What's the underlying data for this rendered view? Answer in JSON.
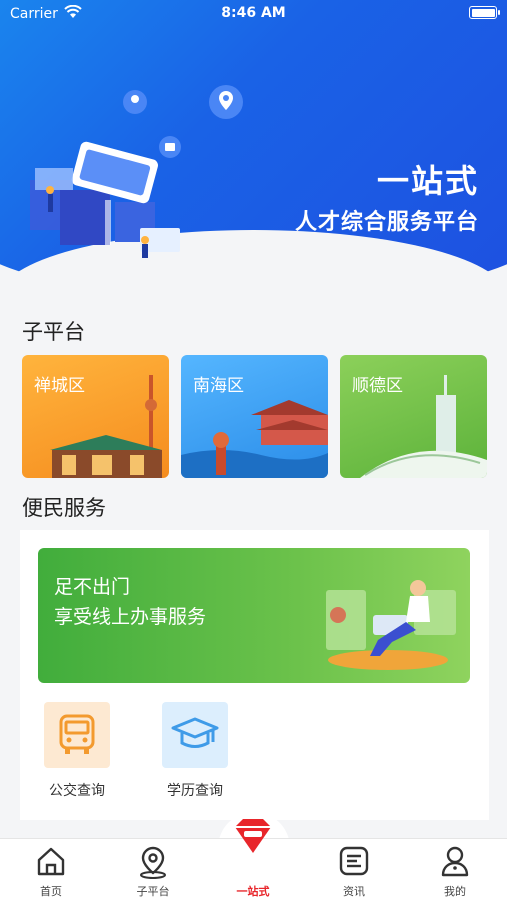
{
  "status_bar": {
    "carrier": "Carrier",
    "time": "8:46 AM"
  },
  "hero": {
    "title": "一站式",
    "subtitle": "人才综合服务平台"
  },
  "sub_platform": {
    "title": "子平台",
    "cards": [
      {
        "label": "禅城区"
      },
      {
        "label": "南海区"
      },
      {
        "label": "顺德区"
      }
    ]
  },
  "services": {
    "title": "便民服务",
    "banner": {
      "line1": "足不出门",
      "line2": "享受线上办事服务"
    },
    "items": [
      {
        "label": "公交查询",
        "icon": "bus-icon"
      },
      {
        "label": "学历查询",
        "icon": "graduation-cap-icon"
      }
    ]
  },
  "tabbar": {
    "tabs": [
      {
        "label": "首页",
        "icon": "home-icon"
      },
      {
        "label": "子平台",
        "icon": "location-pin-icon"
      },
      {
        "label": "一站式",
        "icon": "gem-icon",
        "active": true
      },
      {
        "label": "资讯",
        "icon": "news-icon"
      },
      {
        "label": "我的",
        "icon": "user-icon"
      }
    ]
  },
  "colors": {
    "accent": "#1a62e6",
    "active_tab": "#e8262b"
  }
}
